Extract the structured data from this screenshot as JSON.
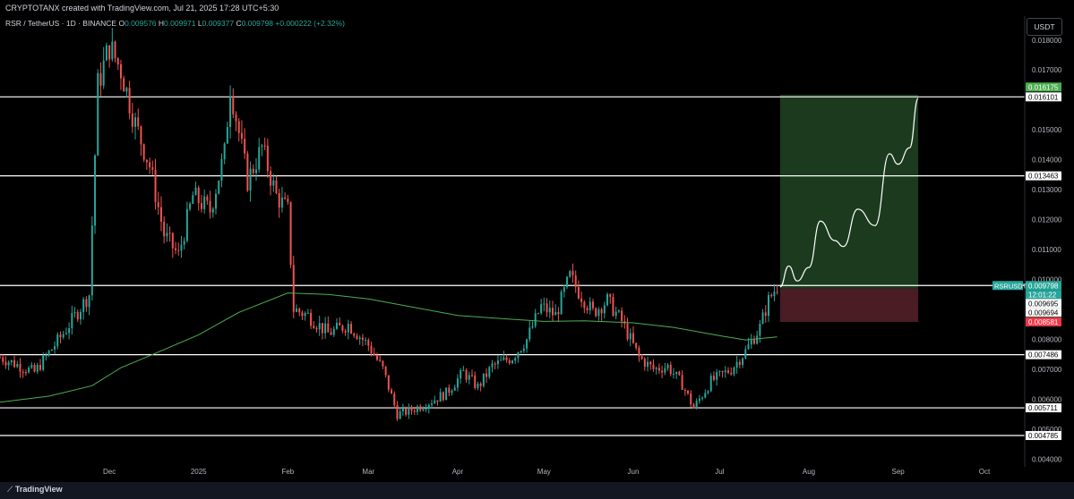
{
  "header": {
    "creator": "CRYPTOTANX created with TradingView.com, Jul 21, 2025 17:28 UTC+5:30",
    "symbol": "RSR / TetherUS · 1D · BINANCE",
    "open_label": "O",
    "open": "0.009576",
    "high_label": "H",
    "high": "0.009971",
    "low_label": "L",
    "low": "0.009377",
    "close_label": "C",
    "close": "0.009798",
    "change": "+0.000222 (+2.32%)"
  },
  "currency_button": "USDT",
  "footer": {
    "brand_mark": "⟋",
    "brand": "TradingView"
  },
  "colors": {
    "background": "#000000",
    "up": "#26a69a",
    "down": "#ef5350",
    "ma": "#4caf50",
    "level_line": "#ffffff",
    "profit_zone": "#1b3a1e",
    "loss_zone": "#4a1c24",
    "target_label": "#4caf50",
    "stop_label": "#f23645",
    "last_price_label": "#26a69a"
  },
  "chart_data": {
    "type": "candlestick",
    "price_scale": "linear",
    "ylim": [
      0.0038,
      0.0188
    ],
    "y_ticks": [
      "0.018000",
      "0.017000",
      "0.015000",
      "0.014000",
      "0.013000",
      "0.012000",
      "0.011000",
      "0.010000",
      "0.008000",
      "0.007000",
      "0.006000",
      "0.005000",
      "0.004000"
    ],
    "x_ticks": [
      {
        "label": "Dec",
        "date": "2024-12-01"
      },
      {
        "label": "2025",
        "date": "2025-01-01"
      },
      {
        "label": "Feb",
        "date": "2025-02-01"
      },
      {
        "label": "Mar",
        "date": "2025-03-01"
      },
      {
        "label": "Apr",
        "date": "2025-04-01"
      },
      {
        "label": "May",
        "date": "2025-05-01"
      },
      {
        "label": "Jun",
        "date": "2025-06-01"
      },
      {
        "label": "Jul",
        "date": "2025-07-01"
      },
      {
        "label": "Aug",
        "date": "2025-08-01"
      },
      {
        "label": "Sep",
        "date": "2025-09-01"
      },
      {
        "label": "Oct",
        "date": "2025-10-01"
      }
    ],
    "date_range": [
      "2024-10-24",
      "2025-10-15"
    ],
    "horizontal_levels": [
      "0.016101",
      "0.013463",
      "0.009798",
      "0.007486",
      "0.005711",
      "0.004785"
    ],
    "price_labels": [
      {
        "value": "0.016175",
        "kind": "target"
      },
      {
        "value": "0.016101",
        "kind": "level"
      },
      {
        "value": "0.013463",
        "kind": "level"
      },
      {
        "value": "0.009798",
        "kind": "last"
      },
      {
        "value": "12:01:22",
        "kind": "countdown"
      },
      {
        "value": "0.009695",
        "kind": "level"
      },
      {
        "value": "0.009694",
        "kind": "level"
      },
      {
        "value": "0.008581",
        "kind": "stop"
      },
      {
        "value": "0.007486",
        "kind": "level"
      },
      {
        "value": "0.005711",
        "kind": "level"
      },
      {
        "value": "0.004785",
        "kind": "level"
      }
    ],
    "symbol_label": "RSRUSDT",
    "position": {
      "start_date": "2025-07-22",
      "end_date": "2025-09-08",
      "entry": 0.009695,
      "target": 0.016175,
      "stop": 0.008581
    },
    "projection": [
      [
        "2025-07-22",
        0.00975
      ],
      [
        "2025-07-25",
        0.01045
      ],
      [
        "2025-07-28",
        0.00995
      ],
      [
        "2025-08-01",
        0.0104
      ],
      [
        "2025-08-05",
        0.01195
      ],
      [
        "2025-08-10",
        0.0113
      ],
      [
        "2025-08-13",
        0.0111
      ],
      [
        "2025-08-18",
        0.01235
      ],
      [
        "2025-08-24",
        0.0118
      ],
      [
        "2025-08-29",
        0.0142
      ],
      [
        "2025-09-01",
        0.01385
      ],
      [
        "2025-09-05",
        0.0144
      ],
      [
        "2025-09-08",
        0.01605
      ]
    ],
    "moving_average": [
      [
        "2024-10-24",
        0.0059
      ],
      [
        "2024-11-10",
        0.0061
      ],
      [
        "2024-11-25",
        0.00645
      ],
      [
        "2024-12-05",
        0.00705
      ],
      [
        "2024-12-15",
        0.00745
      ],
      [
        "2025-01-01",
        0.00815
      ],
      [
        "2025-01-15",
        0.0089
      ],
      [
        "2025-02-01",
        0.00955
      ],
      [
        "2025-02-15",
        0.0095
      ],
      [
        "2025-03-01",
        0.00935
      ],
      [
        "2025-03-15",
        0.0091
      ],
      [
        "2025-04-01",
        0.0088
      ],
      [
        "2025-04-15",
        0.0087
      ],
      [
        "2025-05-01",
        0.0086
      ],
      [
        "2025-05-15",
        0.00862
      ],
      [
        "2025-06-01",
        0.00855
      ],
      [
        "2025-06-15",
        0.0084
      ],
      [
        "2025-07-01",
        0.00812
      ],
      [
        "2025-07-10",
        0.00798
      ],
      [
        "2025-07-21",
        0.00808
      ]
    ],
    "anchors": [
      [
        "2024-10-24",
        0.0074
      ],
      [
        "2024-11-05",
        0.0069
      ],
      [
        "2024-11-15",
        0.0082
      ],
      [
        "2024-11-24",
        0.0095
      ],
      [
        "2024-11-27",
        0.0165
      ],
      [
        "2024-12-01",
        0.0178
      ],
      [
        "2024-12-05",
        0.017
      ],
      [
        "2024-12-10",
        0.0152
      ],
      [
        "2024-12-15",
        0.0138
      ],
      [
        "2024-12-20",
        0.0115
      ],
      [
        "2024-12-25",
        0.0108
      ],
      [
        "2024-12-30",
        0.0128
      ],
      [
        "2025-01-05",
        0.0123
      ],
      [
        "2025-01-10",
        0.0142
      ],
      [
        "2025-01-12",
        0.0165
      ],
      [
        "2025-01-18",
        0.0133
      ],
      [
        "2025-01-23",
        0.0144
      ],
      [
        "2025-01-28",
        0.0128
      ],
      [
        "2025-02-01",
        0.0123
      ],
      [
        "2025-02-03",
        0.009
      ],
      [
        "2025-02-08",
        0.0088
      ],
      [
        "2025-02-15",
        0.0082
      ],
      [
        "2025-02-22",
        0.0085
      ],
      [
        "2025-03-01",
        0.0078
      ],
      [
        "2025-03-06",
        0.007
      ],
      [
        "2025-03-11",
        0.0055
      ],
      [
        "2025-03-15",
        0.0056
      ],
      [
        "2025-03-22",
        0.0059
      ],
      [
        "2025-03-28",
        0.0062
      ],
      [
        "2025-04-03",
        0.0069
      ],
      [
        "2025-04-08",
        0.0064
      ],
      [
        "2025-04-13",
        0.0071
      ],
      [
        "2025-04-20",
        0.0074
      ],
      [
        "2025-04-25",
        0.008
      ],
      [
        "2025-04-30",
        0.0091
      ],
      [
        "2025-05-05",
        0.0088
      ],
      [
        "2025-05-10",
        0.0101
      ],
      [
        "2025-05-13",
        0.0096
      ],
      [
        "2025-05-18",
        0.0089
      ],
      [
        "2025-05-23",
        0.0093
      ],
      [
        "2025-05-28",
        0.0086
      ],
      [
        "2025-06-03",
        0.0074
      ],
      [
        "2025-06-08",
        0.007
      ],
      [
        "2025-06-13",
        0.0071
      ],
      [
        "2025-06-18",
        0.0065
      ],
      [
        "2025-06-22",
        0.0057
      ],
      [
        "2025-06-28",
        0.0066
      ],
      [
        "2025-07-05",
        0.007
      ],
      [
        "2025-07-10",
        0.0076
      ],
      [
        "2025-07-15",
        0.0084
      ],
      [
        "2025-07-18",
        0.0093
      ],
      [
        "2025-07-21",
        0.0098
      ]
    ]
  }
}
